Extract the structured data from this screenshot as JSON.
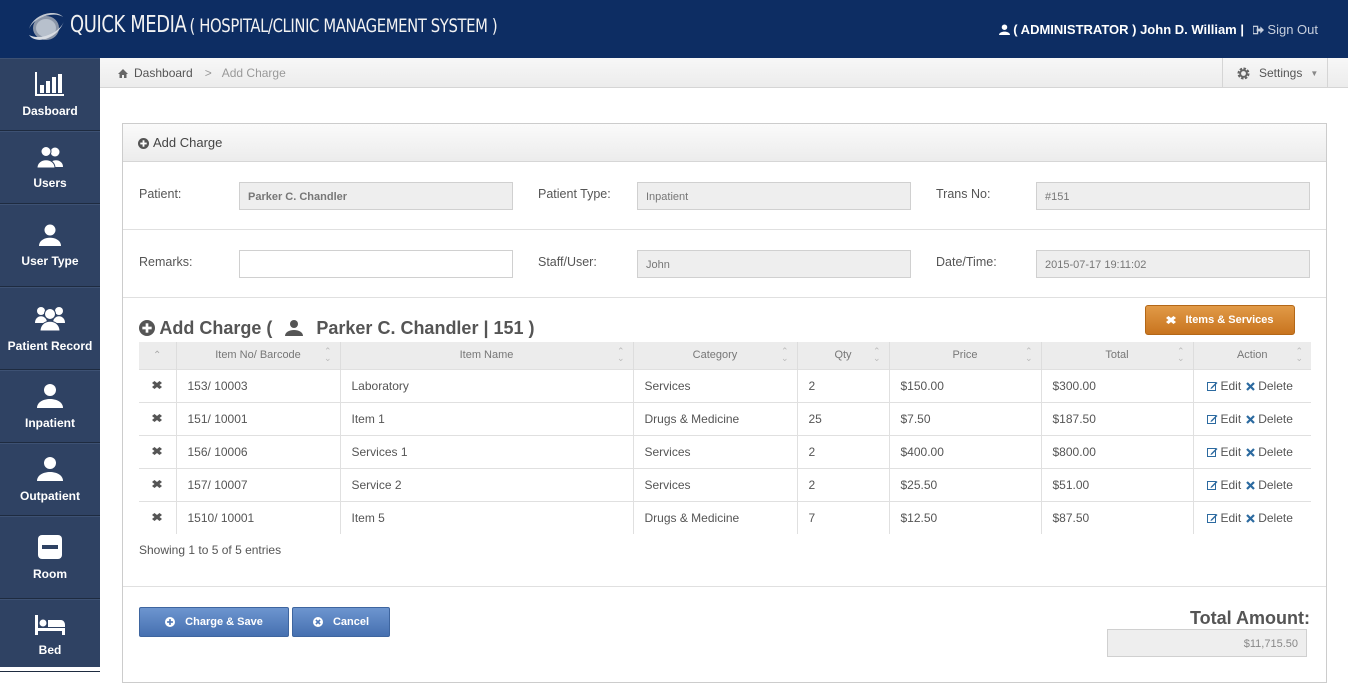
{
  "header": {
    "brand": "QUICK MEDIA",
    "subtitle": "( HOSPITAL/CLINIC MANAGEMENT SYSTEM )",
    "user": "( ADMINISTRATOR ) John D. William |",
    "sign_out": "Sign Out"
  },
  "sidebar": {
    "items": [
      {
        "label": "Dasboard",
        "icon": "bar-chart-icon"
      },
      {
        "label": "Users",
        "icon": "users-icon"
      },
      {
        "label": "User Type",
        "icon": "user-icon"
      },
      {
        "label": "Patient Record",
        "icon": "group-icon"
      },
      {
        "label": "Inpatient",
        "icon": "user-icon"
      },
      {
        "label": "Outpatient",
        "icon": "user-icon"
      },
      {
        "label": "Room",
        "icon": "minus-square-icon"
      },
      {
        "label": "Bed",
        "icon": "bed-icon"
      }
    ]
  },
  "breadcrumb": {
    "home": "Dashboard",
    "separator": ">",
    "current": "Add Charge",
    "settings": "Settings"
  },
  "panel": {
    "title": "Add Charge"
  },
  "form": {
    "patient_label": "Patient:",
    "patient_value": "Parker C. Chandler",
    "patient_type_label": "Patient Type:",
    "patient_type_value": "Inpatient",
    "trans_no_label": "Trans No:",
    "trans_no_value": "#151",
    "remarks_label": "Remarks:",
    "remarks_value": "",
    "staff_label": "Staff/User:",
    "staff_value": "John",
    "datetime_label": "Date/Time:",
    "datetime_value": "2015-07-17 19:11:02"
  },
  "charges": {
    "title_prefix": "Add Charge (",
    "title_patient": "Parker C. Chandler | 151 )",
    "items_button": "Items & Services",
    "columns": [
      "Item No/ Barcode",
      "Item Name",
      "Category",
      "Qty",
      "Price",
      "Total",
      "Action"
    ],
    "rows": [
      {
        "item_no": "153/ 10003",
        "name": "Laboratory",
        "category": "Services",
        "qty": "2",
        "price": "$150.00",
        "total": "$300.00"
      },
      {
        "item_no": "151/ 10001",
        "name": "Item 1",
        "category": "Drugs & Medicine",
        "qty": "25",
        "price": "$7.50",
        "total": "$187.50"
      },
      {
        "item_no": "156/ 10006",
        "name": "Services 1",
        "category": "Services",
        "qty": "2",
        "price": "$400.00",
        "total": "$800.00"
      },
      {
        "item_no": "157/ 10007",
        "name": "Service 2",
        "category": "Services",
        "qty": "2",
        "price": "$25.50",
        "total": "$51.00"
      },
      {
        "item_no": "1510/ 10001",
        "name": "Item 5",
        "category": "Drugs & Medicine",
        "qty": "7",
        "price": "$12.50",
        "total": "$87.50"
      }
    ],
    "edit_label": "Edit",
    "delete_label": "Delete",
    "showing": "Showing 1 to 5 of 5 entries"
  },
  "footer": {
    "charge_save": "Charge & Save",
    "cancel": "Cancel",
    "total_label": "Total Amount:",
    "total_value": "$11,715.50"
  },
  "colors": {
    "header_bg": "#0d2d63",
    "sidebar_bg": "#2f4263",
    "accent_orange": "#d4822e",
    "button_blue": "#5a82c0",
    "link_blue": "#2c6aa0"
  }
}
